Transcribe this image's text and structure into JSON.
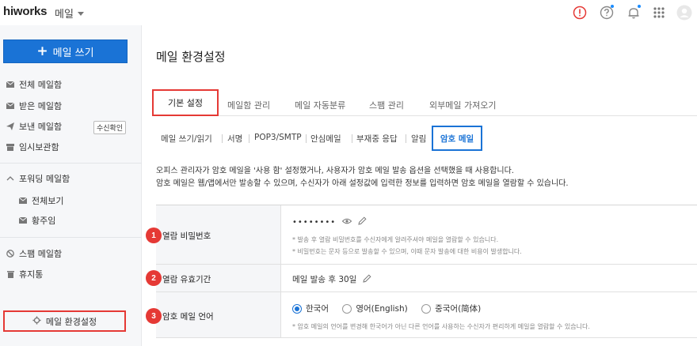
{
  "header": {
    "logo": "hiworks",
    "app_name": "메일",
    "icons": [
      "alert-icon",
      "help-icon",
      "bell-icon",
      "apps-grid-icon",
      "user-avatar-icon"
    ]
  },
  "sidebar": {
    "compose_label": "메일 쓰기",
    "items": [
      {
        "label": "전체 메일함",
        "icon": "mail-icon"
      },
      {
        "label": "받은 메일함",
        "icon": "mail-icon"
      },
      {
        "label": "보낸 메일함",
        "icon": "send-icon"
      },
      {
        "label": "임시보관함",
        "icon": "archive-icon"
      },
      {
        "label": "포워딩 메일함",
        "icon": "chevron-up-icon"
      },
      {
        "label": "전체보기",
        "icon": "mail-icon"
      },
      {
        "label": "황주임",
        "icon": "mail-icon"
      },
      {
        "label": "스팸 메일함",
        "icon": "block-icon"
      },
      {
        "label": "휴지통",
        "icon": "trash-icon"
      }
    ],
    "receipt_check": "수신확인",
    "settings_label": "메일 환경설정"
  },
  "main": {
    "title": "메일 환경설정",
    "tabs": [
      "기본 설정",
      "메일함 관리",
      "메일 자동분류",
      "스팸 관리",
      "외부메일 가져오기"
    ],
    "subtabs": [
      "메일 쓰기/읽기",
      "서명",
      "POP3/SMTP",
      "안심메일",
      "부재중 응답",
      "알림",
      "암호 메일"
    ],
    "description": [
      "오피스 관리자가 암호 메일을 '사용 함' 설정했거나, 사용자가 암호 메일 발송 옵션을 선택했을 때 사용합니다.",
      "암호 메일은 웹/앱에서만 발송할 수 있으며, 수신자가 아래 설정값에 입력한 정보를 입력하면 암호 메일을 열람할 수 있습니다."
    ],
    "rows": [
      {
        "num": "1",
        "label": "열람 비밀번호",
        "value": "••••••••",
        "notes": [
          "* 발송 후 열람 비밀번호를 수신자에게 알려주셔야 메일을 열람할 수 있습니다.",
          "* 비밀번호는 문자 등으로 발송할 수 있으며, 이때 문자 발송에 대한 비용이 발생합니다."
        ]
      },
      {
        "num": "2",
        "label": "열람 유효기간",
        "value": "메일 발송 후 30일"
      },
      {
        "num": "3",
        "label": "암호 메일 언어",
        "options": [
          "한국어",
          "영어(English)",
          "중국어(简体)"
        ],
        "selected": "한국어",
        "note": "* 암호 메일의 언어를 변경해 한국어가 아닌 다른 언어를 사용하는 수신자가 편리하게 메일을 열람할 수 있습니다."
      }
    ]
  },
  "colors": {
    "accent_blue": "#1a73d6",
    "highlight_red": "#e53935",
    "sidebar_bg": "#f6f7f9"
  }
}
